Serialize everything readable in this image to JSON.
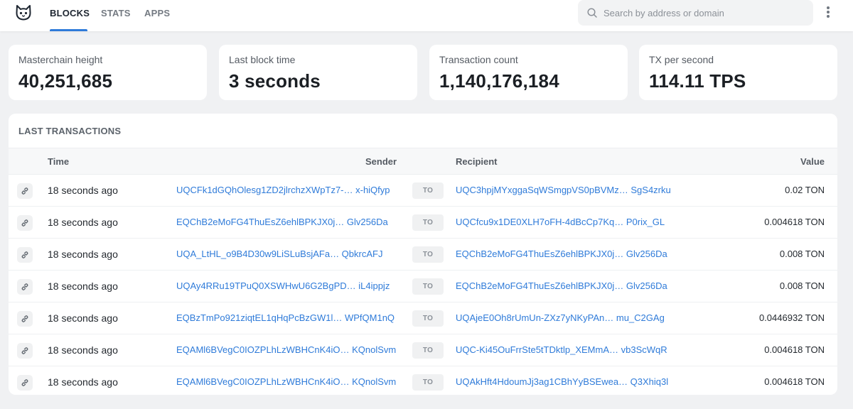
{
  "nav": {
    "tabs": [
      {
        "label": "BLOCKS",
        "active": true
      },
      {
        "label": "STATS",
        "active": false
      },
      {
        "label": "APPS",
        "active": false
      }
    ]
  },
  "search": {
    "placeholder": "Search by address or domain",
    "value": "",
    "icon": "search-icon"
  },
  "menu_icon": "more-vertical-icon",
  "stats": [
    {
      "label": "Masterchain height",
      "value": "40,251,685"
    },
    {
      "label": "Last block time",
      "value": "3 seconds"
    },
    {
      "label": "Transaction count",
      "value": "1,140,176,184"
    },
    {
      "label": "TX per second",
      "value": "114.11 TPS"
    }
  ],
  "transactions": {
    "title": "LAST TRANSACTIONS",
    "columns": {
      "time": "Time",
      "sender": "Sender",
      "recipient": "Recipient",
      "value": "Value"
    },
    "to_label": "TO",
    "rows": [
      {
        "time": "18 seconds ago",
        "sender": "UQCFk1dGQhOlesg1ZD2jlrchzXWpTz7-… x-hiQfyp",
        "recipient": "UQC3hpjMYxggaSqWSmgpVS0pBVMz… SgS4zrku",
        "value": "0.02 TON"
      },
      {
        "time": "18 seconds ago",
        "sender": "EQChB2eMoFG4ThuEsZ6ehlBPKJX0j… Glv256Da",
        "recipient": "UQCfcu9x1DE0XLH7oFH-4dBcCp7Kq… P0rix_GL",
        "value": "0.004618 TON"
      },
      {
        "time": "18 seconds ago",
        "sender": "UQA_LtHL_o9B4D30w9LiSLuBsjAFa… QbkrcAFJ",
        "recipient": "EQChB2eMoFG4ThuEsZ6ehlBPKJX0j… Glv256Da",
        "value": "0.008 TON"
      },
      {
        "time": "18 seconds ago",
        "sender": "UQAy4RRu19TPuQ0XSWHwU6G2BgPD… iL4ippjz",
        "recipient": "EQChB2eMoFG4ThuEsZ6ehlBPKJX0j… Glv256Da",
        "value": "0.008 TON"
      },
      {
        "time": "18 seconds ago",
        "sender": "EQBzTmPo921ziqtEL1qHqPcBzGW1l… WPfQM1nQ",
        "recipient": "UQAjeE0Oh8rUmUn-ZXz7yNKyPAn… mu_C2GAg",
        "value": "0.0446932 TON"
      },
      {
        "time": "18 seconds ago",
        "sender": "EQAMl6BVegC0IOZPLhLzWBHCnK4iO… KQnolSvm",
        "recipient": "UQC-Ki45OuFrrSte5tTDktlp_XEMmA… vb3ScWqR",
        "value": "0.004618 TON"
      },
      {
        "time": "18 seconds ago",
        "sender": "EQAMl6BVegC0IOZPLhLzWBHCnK4iO… KQnolSvm",
        "recipient": "UQAkHft4HdoumJj3ag1CBhYyBSEwea… Q3Xhiq3l",
        "value": "0.004618 TON"
      }
    ]
  },
  "colors": {
    "accent": "#2f7bd9",
    "page_bg": "#f0f1f3",
    "card_bg": "#ffffff"
  }
}
